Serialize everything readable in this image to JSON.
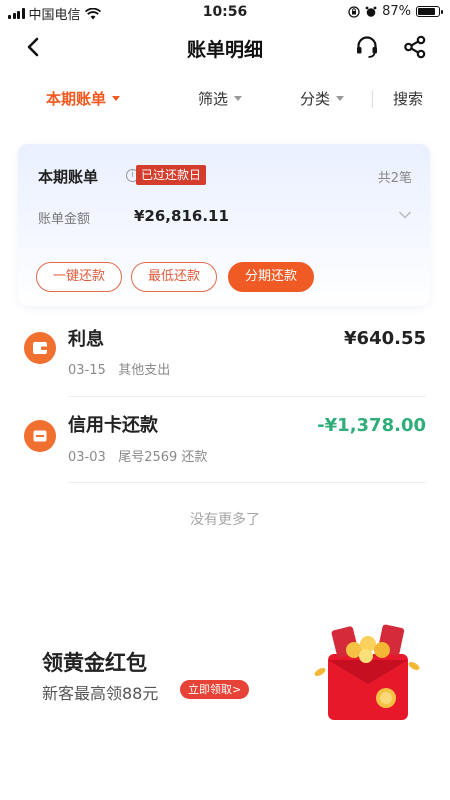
{
  "status_bar": {
    "carrier": "中国电信",
    "time": "10:56",
    "battery": "87%",
    "battery_level": 0.87
  },
  "nav": {
    "title": "账单明细",
    "back_icon": "chevron-left-icon",
    "support_icon": "headset-icon",
    "share_icon": "share-icon"
  },
  "filters": {
    "current_bill": "本期账单",
    "filter": "筛选",
    "category": "分类",
    "search": "搜索"
  },
  "bill_card": {
    "title": "本期账单",
    "info_icon": "info-icon",
    "due_badge": "已过还款日",
    "count": "共2笔",
    "amount_label": "账单金额",
    "amount": "¥26,816.11",
    "buttons": {
      "one_click": "一键还款",
      "minimum": "最低还款",
      "installment": "分期还款"
    }
  },
  "transactions": [
    {
      "title": "利息",
      "date": "03-15",
      "desc": "其他支出",
      "amount": "¥640.55",
      "amount_color": "#222222",
      "icon": "wallet-icon"
    },
    {
      "title": "信用卡还款",
      "date": "03-03",
      "desc": "尾号2569   还款",
      "amount": "-¥1,378.00",
      "amount_color": "#2fae7a",
      "icon": "card-icon"
    }
  ],
  "no_more": "没有更多了",
  "promo": {
    "title": "领黄金红包",
    "subtitle": "新客最高领88元",
    "cta": "立即领取>",
    "image_icon": "red-envelope-icon"
  },
  "colors": {
    "accent": "#f05a24",
    "badge_red": "#d43c2c",
    "refund_green": "#2fae7a"
  }
}
